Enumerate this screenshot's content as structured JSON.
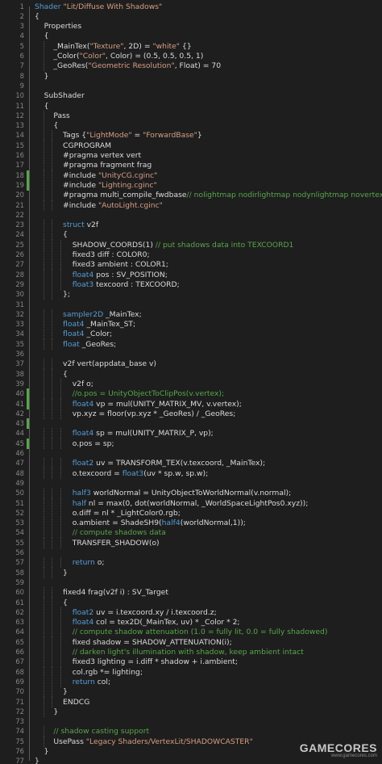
{
  "editor": {
    "colors": {
      "background": "#1e1e1e",
      "keyword": "#569cd6",
      "string": "#d69d85",
      "comment": "#57a64a",
      "plain": "#dcdcdc",
      "line_number": "#858585",
      "changed_marker": "#57a64a"
    },
    "changed_lines": [
      18,
      19,
      40,
      41,
      43,
      45
    ],
    "lines": [
      [
        [
          "kw",
          "Shader "
        ],
        [
          "str",
          "\"Lit/Diffuse With Shadows\""
        ]
      ],
      [
        [
          "pl",
          "{"
        ]
      ],
      [
        [
          "pl",
          "    Properties"
        ]
      ],
      [
        [
          "pl",
          "    {"
        ]
      ],
      [
        [
          "pl",
          "        _MainTex("
        ],
        [
          "str",
          "\"Texture\""
        ],
        [
          "pl",
          ", 2D) = "
        ],
        [
          "str",
          "\"white\""
        ],
        [
          "pl",
          " {}"
        ]
      ],
      [
        [
          "pl",
          "        _Color("
        ],
        [
          "str",
          "\"Color\""
        ],
        [
          "pl",
          ", Color) = (0.5, 0.5, 0.5, 1)"
        ]
      ],
      [
        [
          "pl",
          "        _GeoRes("
        ],
        [
          "str",
          "\"Geometric Resolution\""
        ],
        [
          "pl",
          ", Float) = 70"
        ]
      ],
      [
        [
          "pl",
          "    }"
        ]
      ],
      [
        [
          "pl",
          ""
        ]
      ],
      [
        [
          "pl",
          "    SubShader"
        ]
      ],
      [
        [
          "pl",
          "    {"
        ]
      ],
      [
        [
          "pl",
          "        Pass"
        ]
      ],
      [
        [
          "pl",
          "        {"
        ]
      ],
      [
        [
          "pl",
          "            Tags {"
        ],
        [
          "str",
          "\"LightMode\""
        ],
        [
          "pl",
          " = "
        ],
        [
          "str",
          "\"ForwardBase\""
        ],
        [
          "pl",
          "}"
        ]
      ],
      [
        [
          "pl",
          "            CGPROGRAM"
        ]
      ],
      [
        [
          "pl",
          "            #pragma vertex vert"
        ]
      ],
      [
        [
          "pl",
          "            #pragma fragment frag"
        ]
      ],
      [
        [
          "pl",
          "            #include "
        ],
        [
          "str",
          "\"UnityCG.cginc\""
        ]
      ],
      [
        [
          "pl",
          "            #include "
        ],
        [
          "str",
          "\"Lighting.cginc\""
        ]
      ],
      [
        [
          "pl",
          "            #pragma multi_compile_fwdbase"
        ],
        [
          "cm",
          "// nolightmap nodirlightmap nodynlightmap novertexlight"
        ]
      ],
      [
        [
          "pl",
          "            #include "
        ],
        [
          "str",
          "\"AutoLight.cginc\""
        ]
      ],
      [
        [
          "pl",
          ""
        ]
      ],
      [
        [
          "pl",
          "            "
        ],
        [
          "kw",
          "struct"
        ],
        [
          "pl",
          " v2f"
        ]
      ],
      [
        [
          "pl",
          "            {"
        ]
      ],
      [
        [
          "pl",
          "                SHADOW_COORDS(1) "
        ],
        [
          "cm",
          "// put shadows data into TEXCOORD1"
        ]
      ],
      [
        [
          "pl",
          "                fixed3 diff : COLOR0;"
        ]
      ],
      [
        [
          "pl",
          "                fixed3 ambient : COLOR1;"
        ]
      ],
      [
        [
          "pl",
          "                "
        ],
        [
          "kw",
          "float4"
        ],
        [
          "pl",
          " pos : SV_POSITION;"
        ]
      ],
      [
        [
          "pl",
          "                "
        ],
        [
          "kw",
          "float3"
        ],
        [
          "pl",
          " texcoord : TEXCOORD;"
        ]
      ],
      [
        [
          "pl",
          "            };"
        ]
      ],
      [
        [
          "pl",
          ""
        ]
      ],
      [
        [
          "pl",
          "            "
        ],
        [
          "kw",
          "sampler2D"
        ],
        [
          "pl",
          " _MainTex;"
        ]
      ],
      [
        [
          "pl",
          "            "
        ],
        [
          "kw",
          "float4"
        ],
        [
          "pl",
          " _MainTex_ST;"
        ]
      ],
      [
        [
          "pl",
          "            "
        ],
        [
          "kw",
          "float4"
        ],
        [
          "pl",
          " _Color;"
        ]
      ],
      [
        [
          "pl",
          "            "
        ],
        [
          "kw",
          "float"
        ],
        [
          "pl",
          " _GeoRes;"
        ]
      ],
      [
        [
          "pl",
          ""
        ]
      ],
      [
        [
          "pl",
          "            v2f vert(appdata_base v)"
        ]
      ],
      [
        [
          "pl",
          "            {"
        ]
      ],
      [
        [
          "pl",
          "                v2f o;"
        ]
      ],
      [
        [
          "pl",
          "                "
        ],
        [
          "cm",
          "//o.pos = UnityObjectToClipPos(v.vertex);"
        ]
      ],
      [
        [
          "pl",
          "                "
        ],
        [
          "kw",
          "float4"
        ],
        [
          "pl",
          " vp = mul(UNITY_MATRIX_MV, v.vertex);"
        ]
      ],
      [
        [
          "pl",
          "                vp.xyz = floor(vp.xyz * _GeoRes) / _GeoRes;"
        ]
      ],
      [
        [
          "pl",
          ""
        ]
      ],
      [
        [
          "pl",
          "                "
        ],
        [
          "kw",
          "float4"
        ],
        [
          "pl",
          " sp = mul(UNITY_MATRIX_P, vp);"
        ]
      ],
      [
        [
          "pl",
          "                o.pos = sp;"
        ]
      ],
      [
        [
          "pl",
          ""
        ]
      ],
      [
        [
          "pl",
          "                "
        ],
        [
          "kw",
          "float2"
        ],
        [
          "pl",
          " uv = TRANSFORM_TEX(v.texcoord, _MainTex);"
        ]
      ],
      [
        [
          "pl",
          "                o.texcoord = "
        ],
        [
          "kw",
          "float3"
        ],
        [
          "pl",
          "(uv * sp.w, sp.w);"
        ]
      ],
      [
        [
          "pl",
          ""
        ]
      ],
      [
        [
          "pl",
          "                "
        ],
        [
          "kw",
          "half3"
        ],
        [
          "pl",
          " worldNormal = UnityObjectToWorldNormal(v.normal);"
        ]
      ],
      [
        [
          "pl",
          "                "
        ],
        [
          "kw",
          "half"
        ],
        [
          "pl",
          " nl = max(0, dot(worldNormal, _WorldSpaceLightPos0.xyz));"
        ]
      ],
      [
        [
          "pl",
          "                o.diff = nl * _LightColor0.rgb;"
        ]
      ],
      [
        [
          "pl",
          "                o.ambient = ShadeSH9("
        ],
        [
          "kw",
          "half4"
        ],
        [
          "pl",
          "(worldNormal,1));"
        ]
      ],
      [
        [
          "pl",
          "                "
        ],
        [
          "cm",
          "// compute shadows data"
        ]
      ],
      [
        [
          "pl",
          "                TRANSFER_SHADOW(o)"
        ]
      ],
      [
        [
          "pl",
          ""
        ]
      ],
      [
        [
          "pl",
          "                "
        ],
        [
          "kw",
          "return"
        ],
        [
          "pl",
          " o;"
        ]
      ],
      [
        [
          "pl",
          "            }"
        ]
      ],
      [
        [
          "pl",
          ""
        ]
      ],
      [
        [
          "pl",
          "            fixed4 frag(v2f i) : SV_Target"
        ]
      ],
      [
        [
          "pl",
          "            {"
        ]
      ],
      [
        [
          "pl",
          "                "
        ],
        [
          "kw",
          "float2"
        ],
        [
          "pl",
          " uv = i.texcoord.xy / i.texcoord.z;"
        ]
      ],
      [
        [
          "pl",
          "                "
        ],
        [
          "kw",
          "float4"
        ],
        [
          "pl",
          " col = tex2D(_MainTex, uv) * _Color * 2;"
        ]
      ],
      [
        [
          "pl",
          "                "
        ],
        [
          "cm",
          "// compute shadow attenuation (1.0 = fully lit, 0.0 = fully shadowed)"
        ]
      ],
      [
        [
          "pl",
          "                fixed shadow = SHADOW_ATTENUATION(i);"
        ]
      ],
      [
        [
          "pl",
          "                "
        ],
        [
          "cm",
          "// darken light's illumination with shadow, keep ambient intact"
        ]
      ],
      [
        [
          "pl",
          "                fixed3 lighting = i.diff * shadow + i.ambient;"
        ]
      ],
      [
        [
          "pl",
          "                col.rgb *= lighting;"
        ]
      ],
      [
        [
          "pl",
          "                "
        ],
        [
          "kw",
          "return"
        ],
        [
          "pl",
          " col;"
        ]
      ],
      [
        [
          "pl",
          "            }"
        ]
      ],
      [
        [
          "pl",
          "            ENDCG"
        ]
      ],
      [
        [
          "pl",
          "        }"
        ]
      ],
      [
        [
          "pl",
          ""
        ]
      ],
      [
        [
          "pl",
          "        "
        ],
        [
          "cm",
          "// shadow casting support"
        ]
      ],
      [
        [
          "pl",
          "        UsePass "
        ],
        [
          "str",
          "\"Legacy Shaders/VertexLit/SHADOWCASTER\""
        ]
      ],
      [
        [
          "pl",
          "    }"
        ]
      ],
      [
        [
          "pl",
          "}"
        ]
      ]
    ]
  },
  "watermark": {
    "brand": "GAMECORES",
    "site": "www.gamecores.com"
  }
}
